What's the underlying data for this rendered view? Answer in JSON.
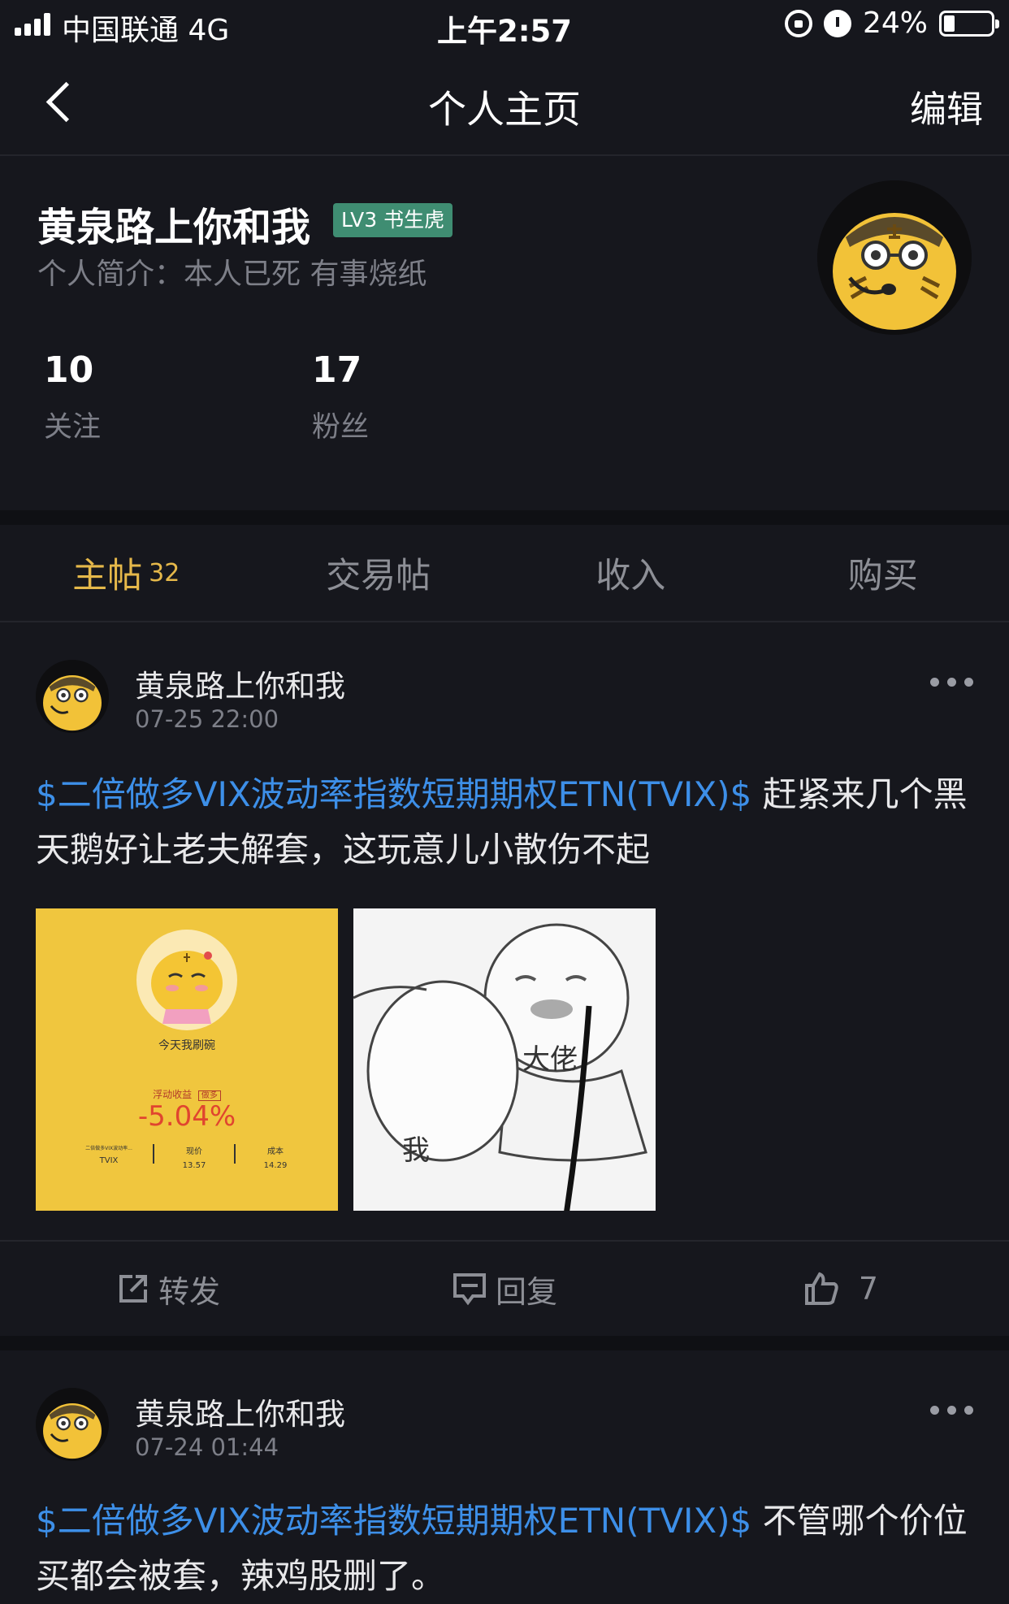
{
  "status_bar": {
    "carrier": "中国联通  4G",
    "time": "上午2:57",
    "battery": "24%",
    "icons": [
      "signal-icon",
      "rotation-lock-icon",
      "alarm-icon",
      "battery-icon"
    ]
  },
  "nav": {
    "back_icon": "chevron-left-icon",
    "title": "个人主页",
    "edit_label": "编辑"
  },
  "profile": {
    "name": "黄泉路上你和我",
    "level": "LV3 书生虎",
    "bio": "个人简介：本人已死 有事烧纸",
    "following_count": "10",
    "following_label": "关注",
    "followers_count": "17",
    "followers_label": "粉丝"
  },
  "tabs": [
    {
      "label": "主帖",
      "count": "32",
      "active": true
    },
    {
      "label": "交易帖",
      "count": "",
      "active": false
    },
    {
      "label": "收入",
      "count": "",
      "active": false
    },
    {
      "label": "购买",
      "count": "",
      "active": false
    }
  ],
  "posts": [
    {
      "author": "黄泉路上你和我",
      "time": "07-25 22:00",
      "ticker": "$二倍做多VIX波动率指数短期期权ETN(TVIX)$",
      "text": " 赶紧来几个黑天鹅好让老夫解套，这玩意儿小散伤不起",
      "image1": {
        "caption": "今天我刷碗",
        "label": "浮动收益",
        "tag": "做多",
        "value": "-5.04%",
        "col1_title": "二倍做多VIX波动率...",
        "col1_value": "TVIX",
        "col2_title": "现价",
        "col2_value": "13.57",
        "col3_title": "成本",
        "col3_value": "14.29"
      },
      "image2": {
        "label_big": "大佬",
        "label_me": "我"
      },
      "actions": {
        "repost": "转发",
        "reply": "回复",
        "like": "7"
      }
    },
    {
      "author": "黄泉路上你和我",
      "time": "07-24 01:44",
      "ticker": "$二倍做多VIX波动率指数短期期权ETN(TVIX)$",
      "text": " 不管哪个价位买都会被套，辣鸡股删了。"
    }
  ],
  "colors": {
    "background": "#16171d",
    "accent_gold": "#e5b84a",
    "link_blue": "#3d8fe8",
    "level_green": "#3f8d72",
    "loss_red": "#e0452f"
  }
}
